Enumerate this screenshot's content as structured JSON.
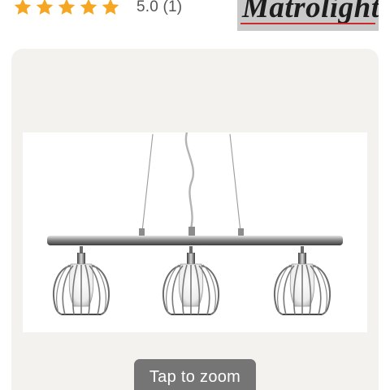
{
  "rating": {
    "stars": 5,
    "star_color": "#f5a623",
    "score_text": "5.0 (1)"
  },
  "brand": {
    "name": "Matrolight",
    "underline_color": "#cc2b2b"
  },
  "gallery": {
    "zoom_label": "Tap to zoom"
  },
  "icons": {
    "star": "star-icon",
    "product": "pendant-lamp-photo"
  }
}
